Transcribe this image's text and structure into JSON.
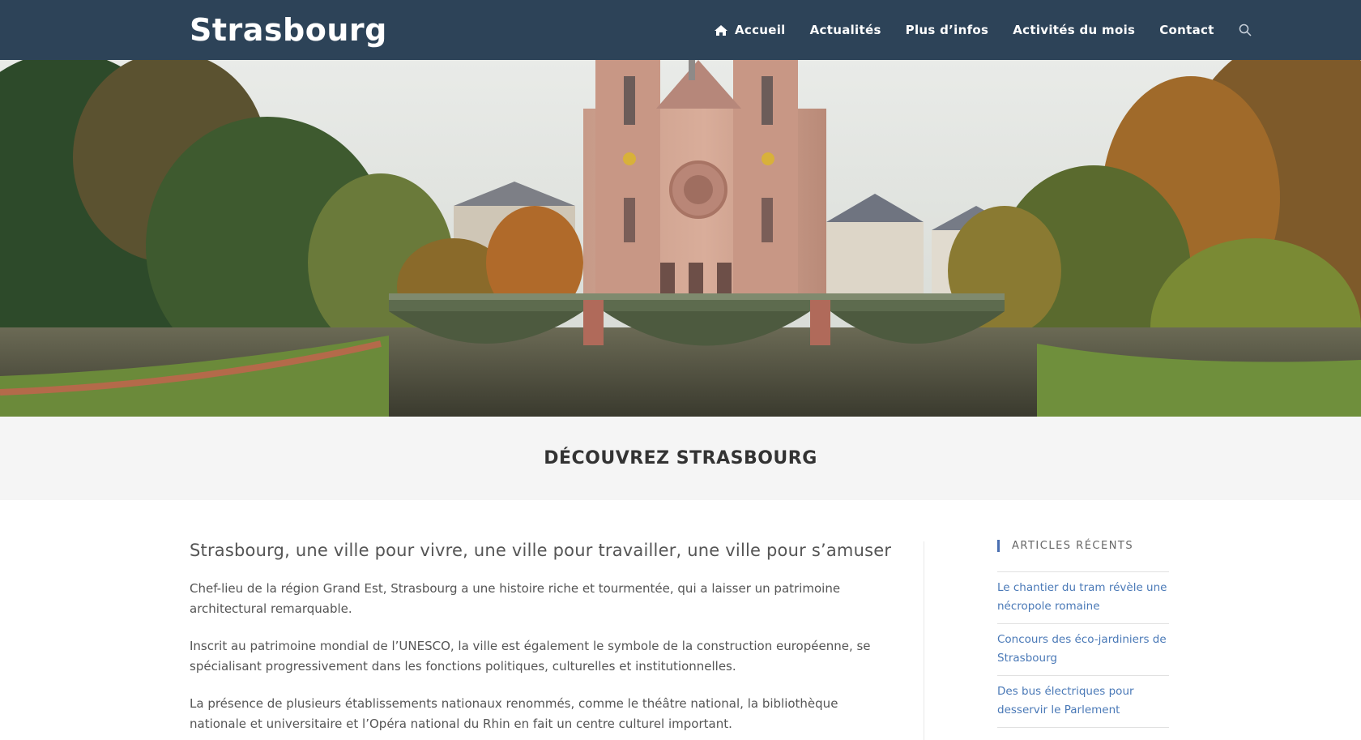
{
  "site": {
    "logo": "Strasbourg"
  },
  "nav": {
    "items": [
      {
        "label": "Accueil",
        "icon": "home-icon"
      },
      {
        "label": "Actualités"
      },
      {
        "label": "Plus d’infos"
      },
      {
        "label": "Activités du mois"
      },
      {
        "label": "Contact"
      }
    ],
    "search_icon": "search-icon"
  },
  "hero": {
    "image": "church-of-saint-paul-strasbourg-with-bridge"
  },
  "page": {
    "title": "DÉCOUVREZ STRASBOURG"
  },
  "article": {
    "lead": "Strasbourg, une ville pour vivre, une ville pour travailler, une ville pour s’amuser",
    "paragraphs": [
      "Chef-lieu de la région Grand Est, Strasbourg a une histoire riche et tourmentée, qui a laisser un patrimoine architectural remarquable.",
      "Inscrit au patrimoine mondial de l’UNESCO, la ville est également le symbole de la construction européenne, se spécialisant progressivement dans les fonctions politiques, culturelles et institutionnelles.",
      "La présence de plusieurs établissements nationaux renommés, comme le théâtre national, la bibliothèque nationale et universitaire et l’Opéra national du Rhin en fait un centre culturel important."
    ]
  },
  "sidebar": {
    "title": "ARTICLES RÉCENTS",
    "items": [
      "Le chantier du tram révèle une nécropole romaine",
      "Concours des éco-jardiniers de Strasbourg",
      "Des bus électriques pour desservir le Parlement"
    ]
  },
  "colors": {
    "header_bg": "#2d4358",
    "title_band_bg": "#f5f5f5",
    "link": "#4a79b7",
    "accent": "#4a6fb1"
  }
}
